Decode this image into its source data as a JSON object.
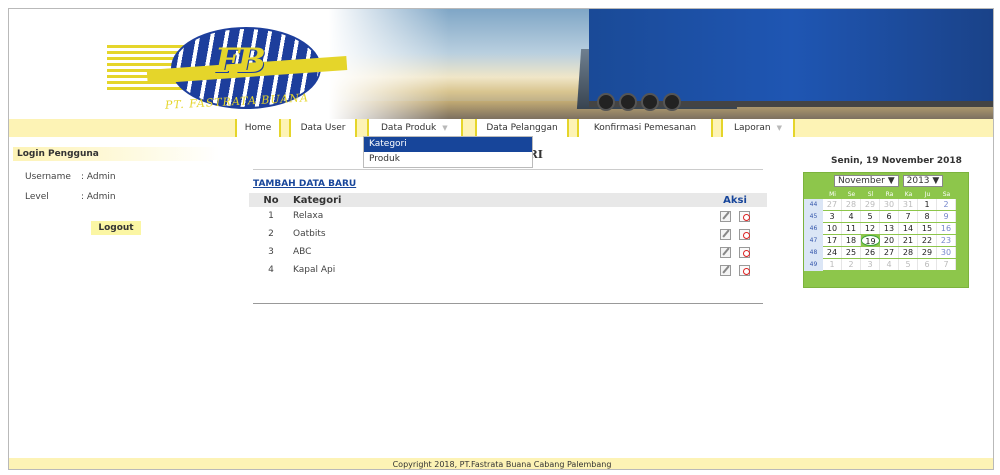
{
  "header": {
    "logo_letters": "FB",
    "logo_sub": "PT. FASTRATA BUANA"
  },
  "nav": {
    "items": [
      {
        "label": "Home"
      },
      {
        "label": "Data User"
      },
      {
        "label": "Data Produk"
      },
      {
        "label": "Data Pelanggan"
      },
      {
        "label": "Konfirmasi Pemesanan"
      },
      {
        "label": "Laporan"
      }
    ],
    "dropdown": [
      {
        "label": "Kategori",
        "active": true
      },
      {
        "label": "Produk",
        "active": false
      }
    ]
  },
  "sidebar": {
    "title": "Login Pengguna",
    "username_label": "Username",
    "username_value": ": Admin",
    "level_label": "Level",
    "level_value": ": Admin",
    "logout_label": "Logout"
  },
  "main": {
    "title_visible": "ORI",
    "add_link": "TAMBAH DATA BARU",
    "columns": {
      "no": "No",
      "kategori": "Kategori",
      "aksi": "Aksi"
    },
    "rows": [
      {
        "no": "1",
        "kategori": "Relaxa"
      },
      {
        "no": "2",
        "kategori": "Oatbits"
      },
      {
        "no": "3",
        "kategori": "ABC"
      },
      {
        "no": "4",
        "kategori": "Kapal Api"
      }
    ]
  },
  "calendar": {
    "date_label": "Senin, 19 November 2018",
    "month": "November",
    "year": "2013",
    "day_names": [
      "Mi",
      "Se",
      "Sl",
      "Ra",
      "Ka",
      "Ju",
      "Sa"
    ],
    "weeks": [
      {
        "wk": "44",
        "days": [
          "27",
          "28",
          "29",
          "30",
          "31",
          "1",
          "2"
        ]
      },
      {
        "wk": "45",
        "days": [
          "3",
          "4",
          "5",
          "6",
          "7",
          "8",
          "9"
        ]
      },
      {
        "wk": "46",
        "days": [
          "10",
          "11",
          "12",
          "13",
          "14",
          "15",
          "16"
        ]
      },
      {
        "wk": "47",
        "days": [
          "17",
          "18",
          "19",
          "20",
          "21",
          "22",
          "23"
        ]
      },
      {
        "wk": "48",
        "days": [
          "24",
          "25",
          "26",
          "27",
          "28",
          "29",
          "30"
        ]
      },
      {
        "wk": "49",
        "days": [
          "1",
          "2",
          "3",
          "4",
          "5",
          "6",
          "7"
        ]
      }
    ],
    "today": "19"
  },
  "footer": {
    "text": "Copyright 2018, PT.Fastrata Buana Cabang Palembang"
  }
}
